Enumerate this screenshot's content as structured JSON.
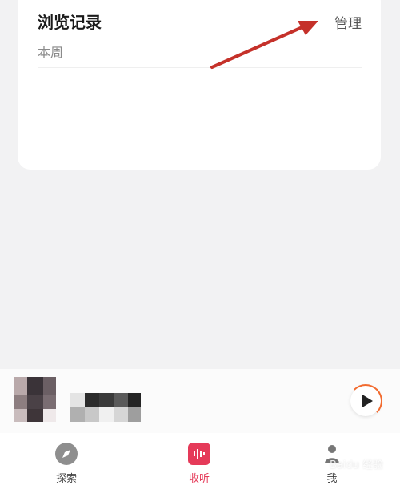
{
  "history_card": {
    "title": "浏览记录",
    "manage_label": "管理",
    "section_label": "本周"
  },
  "annotation": {
    "arrow_color": "#c5312a"
  },
  "player": {
    "play_icon": "play-icon",
    "progress_color": "#f26b2f"
  },
  "tabs": [
    {
      "label": "探索",
      "icon": "compass-icon"
    },
    {
      "label": "收听",
      "icon": "soundwave-icon"
    },
    {
      "label": "我",
      "icon": "profile-icon"
    }
  ],
  "colors": {
    "accent": "#e53a59",
    "background": "#f2f2f3",
    "card": "#ffffff"
  },
  "watermark": "Baidu 经验"
}
